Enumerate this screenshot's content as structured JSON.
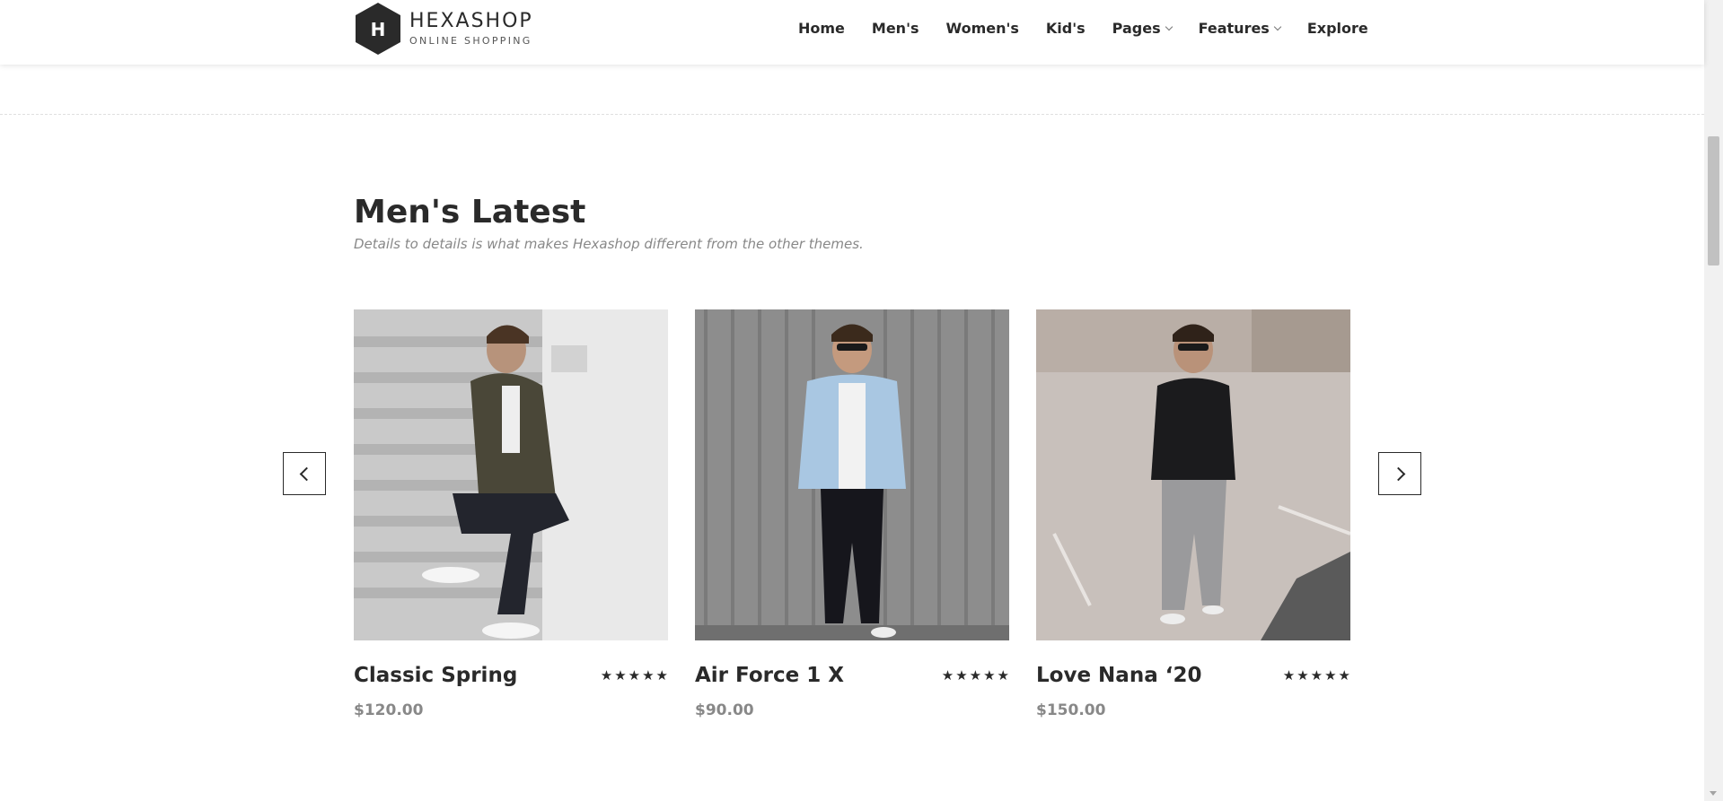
{
  "header": {
    "logo_letter": "H",
    "brand": "HEXASHOP",
    "tagline": "ONLINE SHOPPING",
    "nav": [
      {
        "label": "Home",
        "dropdown": false
      },
      {
        "label": "Men's",
        "dropdown": false
      },
      {
        "label": "Women's",
        "dropdown": false
      },
      {
        "label": "Kid's",
        "dropdown": false
      },
      {
        "label": "Pages",
        "dropdown": true
      },
      {
        "label": "Features",
        "dropdown": true
      },
      {
        "label": "Explore",
        "dropdown": false
      }
    ]
  },
  "section": {
    "title": "Men's Latest",
    "subtitle": "Details to details is what makes Hexashop different from the other themes."
  },
  "products": [
    {
      "name": "Classic Spring",
      "price": "$120.00",
      "rating": 5
    },
    {
      "name": "Air Force 1 X",
      "price": "$90.00",
      "rating": 5
    },
    {
      "name": "Love Nana ‘20",
      "price": "$150.00",
      "rating": 5
    }
  ],
  "colors": {
    "text": "#2a2a2a",
    "muted": "#888888",
    "background": "#ffffff"
  }
}
